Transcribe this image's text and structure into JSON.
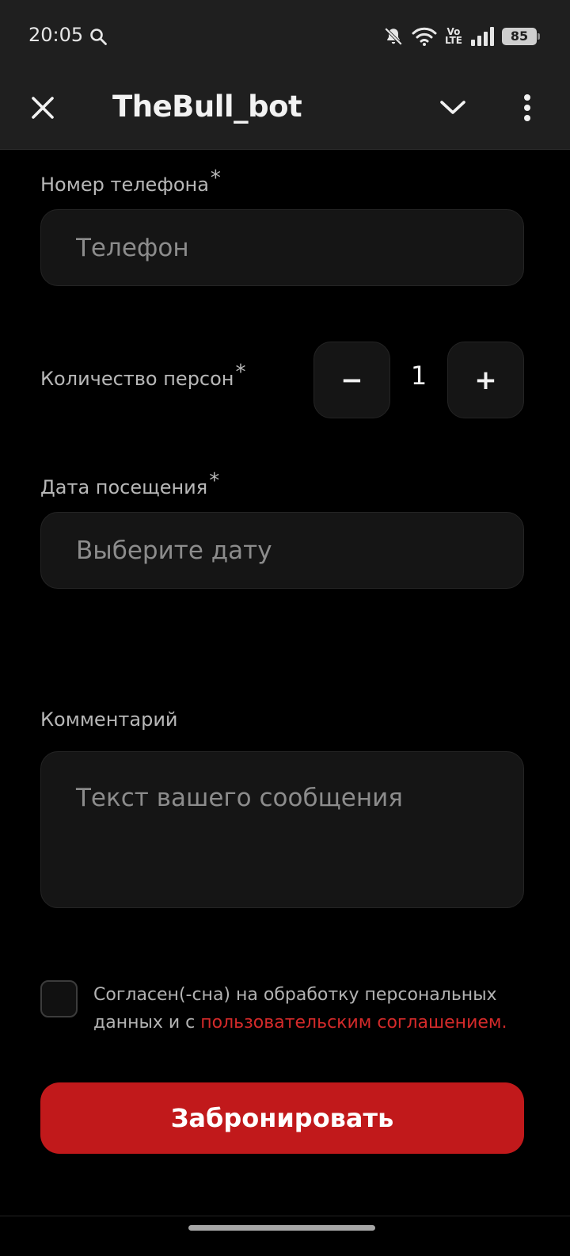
{
  "status_bar": {
    "time": "20:05",
    "volte_top": "Vo",
    "volte_bottom": "LTE",
    "battery": "85"
  },
  "app_bar": {
    "title": "TheBull_bot",
    "close_icon": "close-icon",
    "collapse_icon": "chevron-down-icon",
    "menu_icon": "more-vertical-icon"
  },
  "form": {
    "phone_label": "Номер телефона",
    "phone_placeholder": "Телефон",
    "persons_label": "Количество персон",
    "persons_minus": "−",
    "persons_value": "1",
    "persons_plus": "+",
    "date_label": "Дата посещения",
    "date_placeholder": "Выберите дату",
    "comment_label": "Комментарий",
    "comment_placeholder": "Текст вашего сообщения",
    "required_mark": "*",
    "consent_text": "Согласен(-сна) на обработку персональных данных и с ",
    "consent_link": "пользовательским соглашением.",
    "submit": "Забронировать"
  },
  "colors": {
    "accent": "#c1191b",
    "link": "#d42a2a",
    "background": "#000000",
    "field_bg": "#151515",
    "bar_bg": "#1f1f1f"
  }
}
